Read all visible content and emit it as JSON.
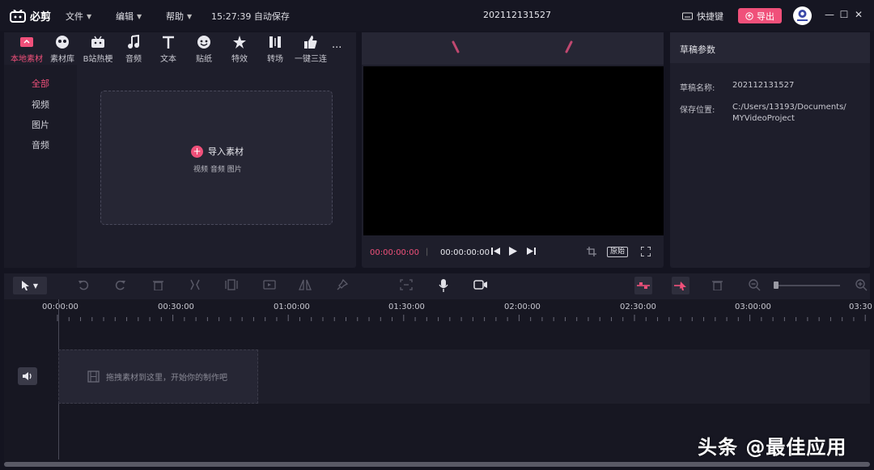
{
  "app": {
    "name": "必剪"
  },
  "menu": {
    "file": "文件",
    "edit": "编辑",
    "help": "帮助"
  },
  "autosave": "15:27:39 自动保存",
  "doc_title": "202112131527",
  "header": {
    "shortcut_label": "快捷键",
    "export_label": "导出"
  },
  "tabs": [
    {
      "label": "本地素材",
      "icon": "upload-icon",
      "active": true
    },
    {
      "label": "素材库",
      "icon": "mascot-icon"
    },
    {
      "label": "B站热梗",
      "icon": "tv-icon"
    },
    {
      "label": "音频",
      "icon": "music-note-icon"
    },
    {
      "label": "文本",
      "icon": "text-t-icon"
    },
    {
      "label": "贴纸",
      "icon": "sticker-icon"
    },
    {
      "label": "特效",
      "icon": "effects-star-icon"
    },
    {
      "label": "转场",
      "icon": "transition-icon"
    },
    {
      "label": "一键三连",
      "icon": "thumb-up-icon"
    }
  ],
  "tabs_more": "...",
  "categories": [
    {
      "label": "全部",
      "active": true
    },
    {
      "label": "视频"
    },
    {
      "label": "图片"
    },
    {
      "label": "音频"
    }
  ],
  "import": {
    "label": "导入素材",
    "sub": "视频 音频 图片"
  },
  "preview": {
    "timecode_current": "00:00:00:00",
    "separator": "|",
    "timecode_total": "00:00:00:00",
    "ratio_label": "原始"
  },
  "draft": {
    "title": "草稿参数",
    "name_label": "草稿名称:",
    "name_value": "202112131527",
    "path_label": "保存位置:",
    "path_value_1": "C:/Users/13193/Documents/",
    "path_value_2": "MYVideoProject"
  },
  "ruler": [
    "00:00:00",
    "00:30:00",
    "01:00:00",
    "01:30:00",
    "02:00:00",
    "02:30:00",
    "03:00:00",
    "03:30"
  ],
  "track": {
    "drop_hint": "拖拽素材到这里，开始你的制作吧"
  },
  "watermark": "头条 @最佳应用",
  "colors": {
    "accent": "#f0507a",
    "bg": "#141420",
    "panel": "#1e1e2b"
  }
}
